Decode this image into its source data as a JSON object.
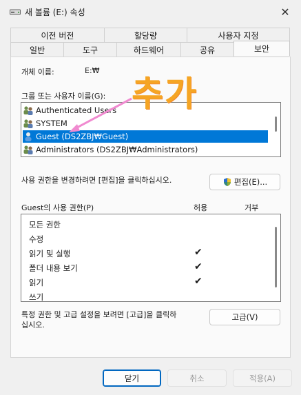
{
  "window": {
    "title": "새 볼륨 (E:) 속성",
    "close_glyph": "✕"
  },
  "tabs_row1": [
    "이전 버전",
    "할당량",
    "사용자 지정"
  ],
  "tabs_row2": [
    "일반",
    "도구",
    "하드웨어",
    "공유",
    "보안"
  ],
  "active_tab": "보안",
  "object_name": {
    "label": "개체 이름:",
    "value": "E:₩"
  },
  "group_list": {
    "label": "그룹 또는 사용자 이름(G):",
    "items": [
      {
        "name": "Authenticated Users",
        "icon": "users-icon",
        "selected": false
      },
      {
        "name": "SYSTEM",
        "icon": "users-icon",
        "selected": false
      },
      {
        "name": "Guest (DS2ZBJ₩Guest)",
        "icon": "user-icon",
        "selected": true
      },
      {
        "name": "Administrators (DS2ZBJ₩Administrators)",
        "icon": "users-icon",
        "selected": false
      }
    ]
  },
  "annotation": {
    "text": "추가",
    "color": "#f5a524"
  },
  "edit_hint": "사용 권한을 변경하려면 [편집]을 클릭하십시오.",
  "edit_button": "편집(E)...",
  "permissions": {
    "label": "Guest의 사용 권한(P)",
    "allow_header": "허용",
    "deny_header": "거부",
    "rows": [
      {
        "name": "모든 권한",
        "allow": false,
        "deny": false
      },
      {
        "name": "수정",
        "allow": false,
        "deny": false
      },
      {
        "name": "읽기 및 실행",
        "allow": true,
        "deny": false
      },
      {
        "name": "폴더 내용 보기",
        "allow": true,
        "deny": false
      },
      {
        "name": "읽기",
        "allow": true,
        "deny": false
      },
      {
        "name": "쓰기",
        "allow": false,
        "deny": false
      }
    ],
    "check_glyph": "✔"
  },
  "advanced_hint_line1": "특정 권한 및 고급 설정을 보려면 [고급]을 클릭하",
  "advanced_hint_line2": "십시오.",
  "advanced_button": "고급(V)",
  "footer": {
    "ok": "닫기",
    "cancel": "취소",
    "apply": "적용(A)"
  },
  "colors": {
    "selection": "#0078d7",
    "accent_border": "#0067c0",
    "annotation": "#f5a524"
  }
}
